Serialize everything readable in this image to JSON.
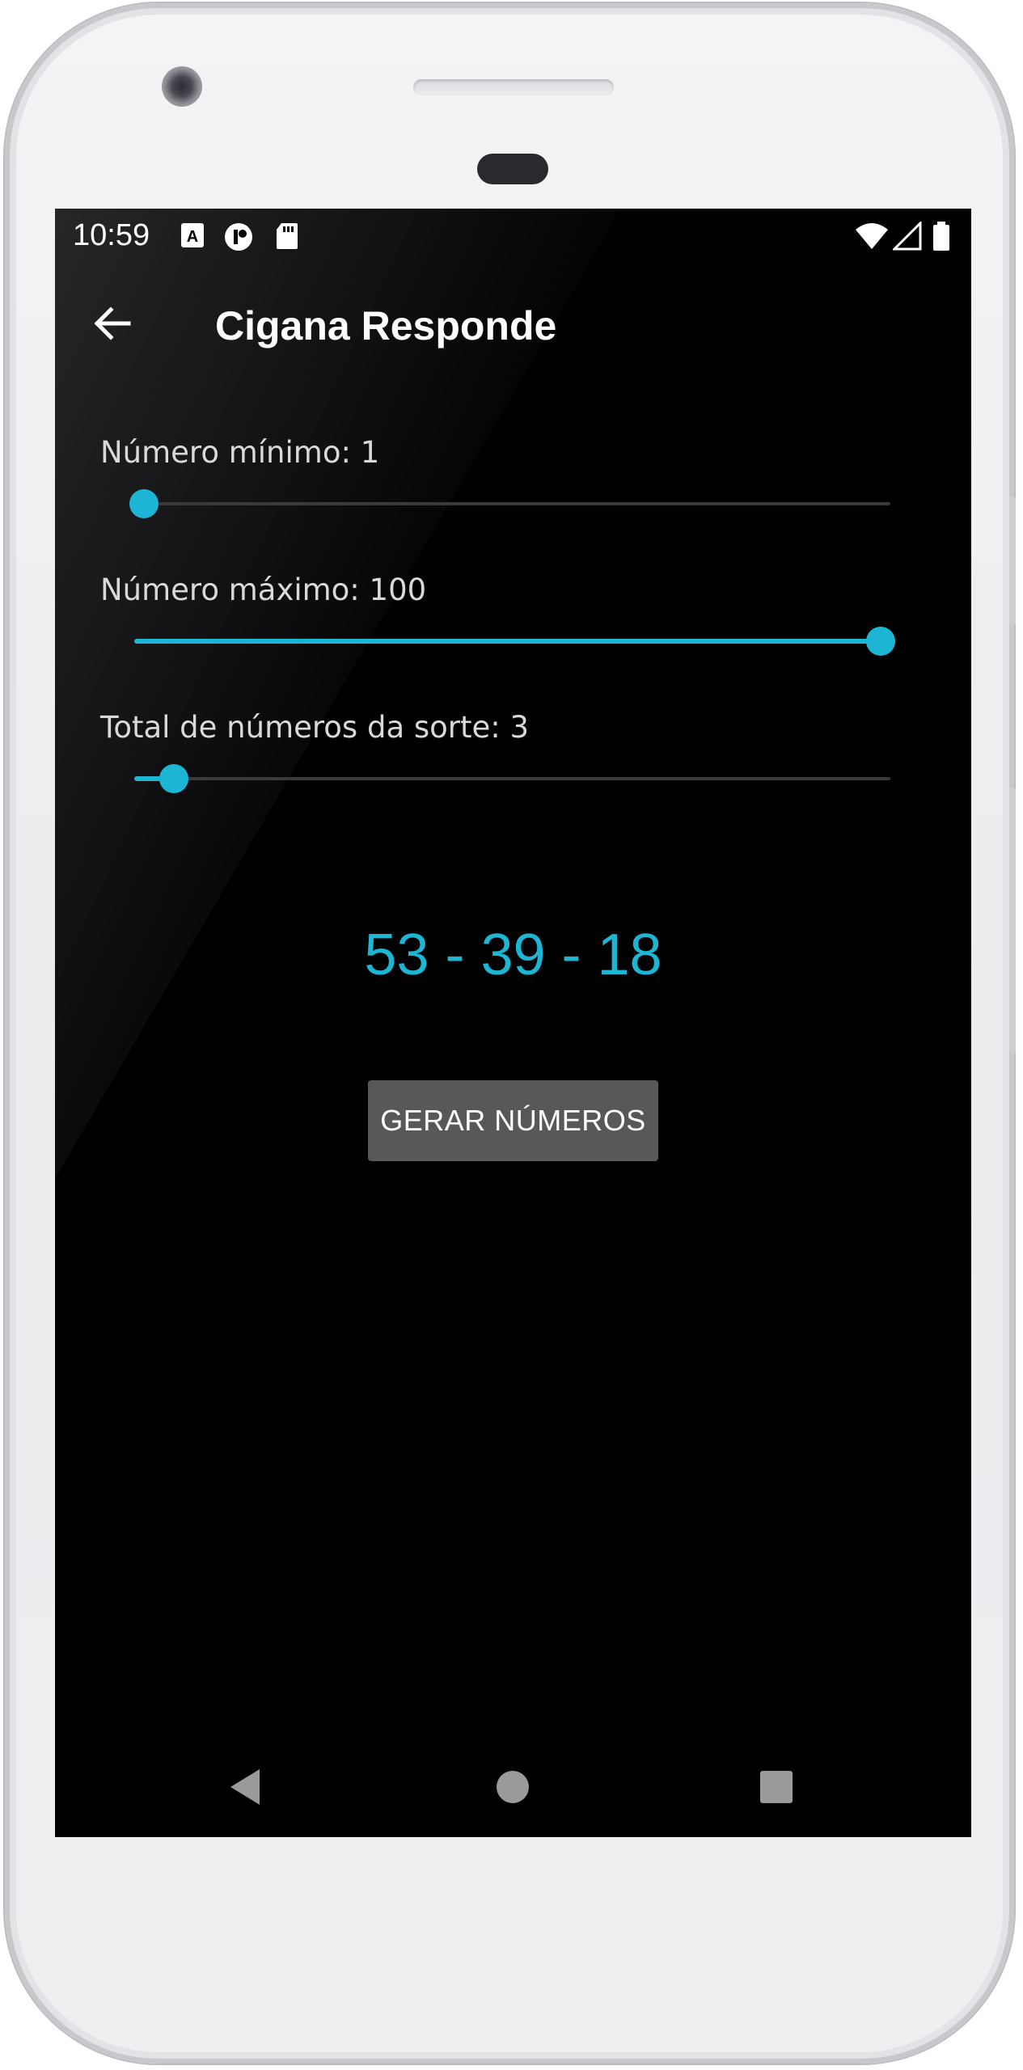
{
  "status_bar": {
    "time": "10:59",
    "icons": [
      "a-notification-icon",
      "app-notification-icon",
      "sd-card-icon",
      "wifi-icon",
      "signal-icon",
      "battery-icon"
    ]
  },
  "app_bar": {
    "title": "Cigana Responde",
    "back_icon": "arrow-back-icon"
  },
  "sliders": [
    {
      "label": "Número mínimo: 1",
      "value": 1,
      "min": 1,
      "max": 100
    },
    {
      "label": "Número máximo: 100",
      "value": 100,
      "min": 1,
      "max": 100
    },
    {
      "label": "Total de números da sorte: 3",
      "value": 3,
      "min": 1,
      "max": 50
    }
  ],
  "result": {
    "text": "53 - 39 - 18"
  },
  "actions": {
    "generate_label": "GERAR NÚMEROS"
  },
  "nav_bar": {
    "icons": [
      "back-triangle-icon",
      "home-circle-icon",
      "recents-square-icon"
    ]
  },
  "colors": {
    "accent": "#1db5d4",
    "background": "#000000",
    "button": "#585858",
    "text": "#ffffff"
  }
}
